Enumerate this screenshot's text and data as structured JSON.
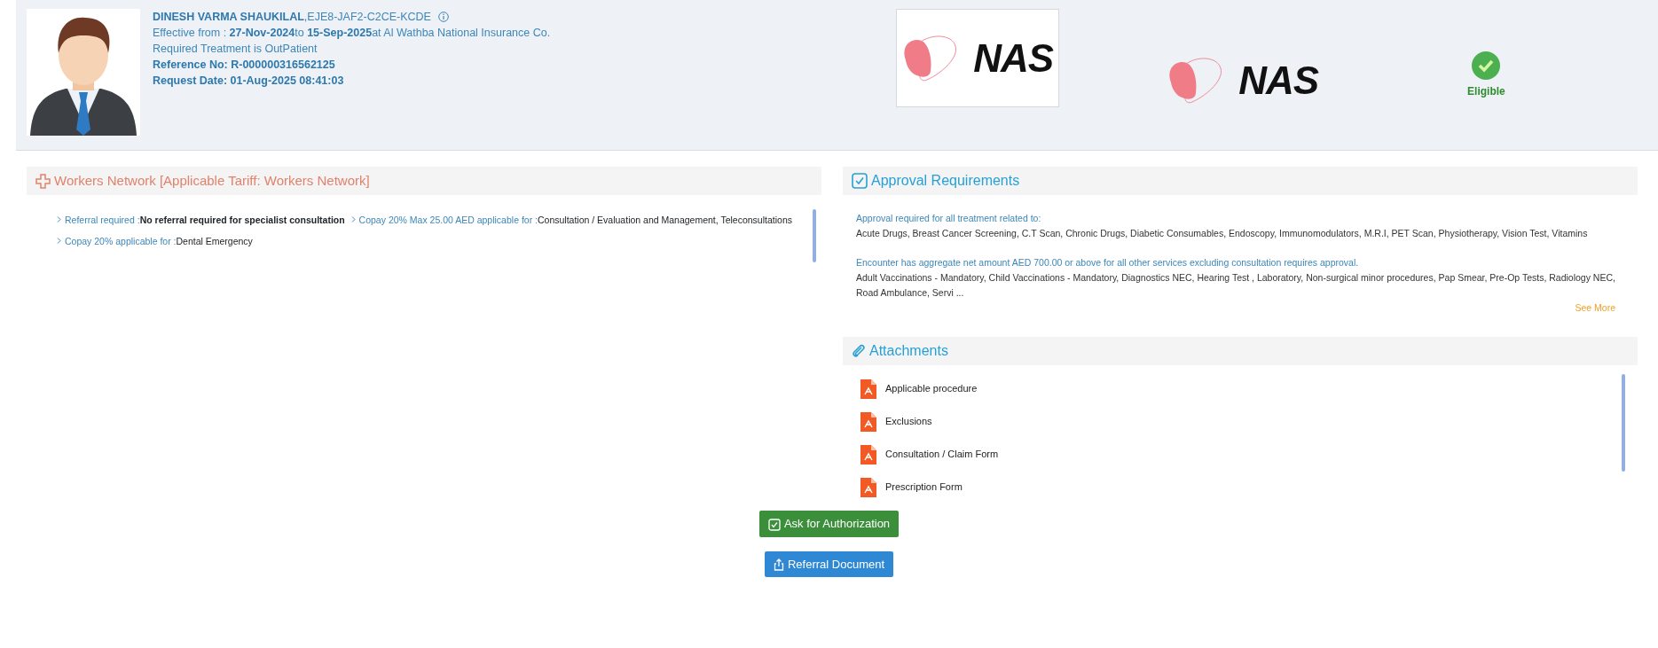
{
  "member": {
    "title": "**DINESH VARMA SHAUKILAL**,EJE8-JAF2-C2CE-KCDE",
    "effective": "Effective from : **27-Nov-2024**to **15-Sep-2025**at Al Wathba National Insurance Co.",
    "treatment": "Required Treatment is OutPatient",
    "reference": "Reference No: R-000000316562125",
    "request_date": "Request Date: 01-Aug-2025 08:41:03"
  },
  "logos": [
    {
      "text": "NAS",
      "framed": true
    },
    {
      "text": "NAS",
      "framed": false
    }
  ],
  "eligibility": {
    "eligible": true,
    "label": "Eligible"
  },
  "network": {
    "title": "Workers Network [Applicable Tariff: Workers Network]",
    "benefits": [
      {
        "label": "Referral required :",
        "value": "No referral required for specialist consultation",
        "bold": true
      },
      {
        "label": "Copay 20% Max 25.00 AED applicable for :",
        "value": "Consultation / Evaluation and Management, Teleconsultations",
        "bold": false
      },
      {
        "label": "Copay 20% applicable for :",
        "value": "Dental Emergency",
        "bold": false
      }
    ]
  },
  "approval": {
    "title": "Approval Requirements",
    "groups": [
      {
        "heading": "Approval required for all treatment related to:",
        "text": "Acute Drugs, Breast Cancer Screening, C.T Scan, Chronic Drugs, Diabetic Consumables, Endoscopy, Immunomodulators, M.R.I, PET Scan, Physiotherapy, Vision Test, Vitamins"
      },
      {
        "heading": "Encounter has aggregate net amount AED 700.00 or above for all other services excluding consultation requires approval.",
        "text": "Adult Vaccinations - Mandatory, Child Vaccinations - Mandatory, Diagnostics NEC, Hearing Test , Laboratory, Non-surgical minor procedures, Pap Smear, Pre-Op Tests, Radiology NEC, Road Ambulance, Servi ..."
      }
    ],
    "see_more": "See More"
  },
  "attachments": {
    "title": "Attachments",
    "files": [
      "Applicable procedure",
      "Exclusions",
      "Consultation / Claim Form",
      "Prescription Form"
    ]
  },
  "actions": [
    {
      "label": "Ask for Authorization",
      "kind": "authorize"
    },
    {
      "label": "Referral Document",
      "kind": "referral"
    }
  ]
}
